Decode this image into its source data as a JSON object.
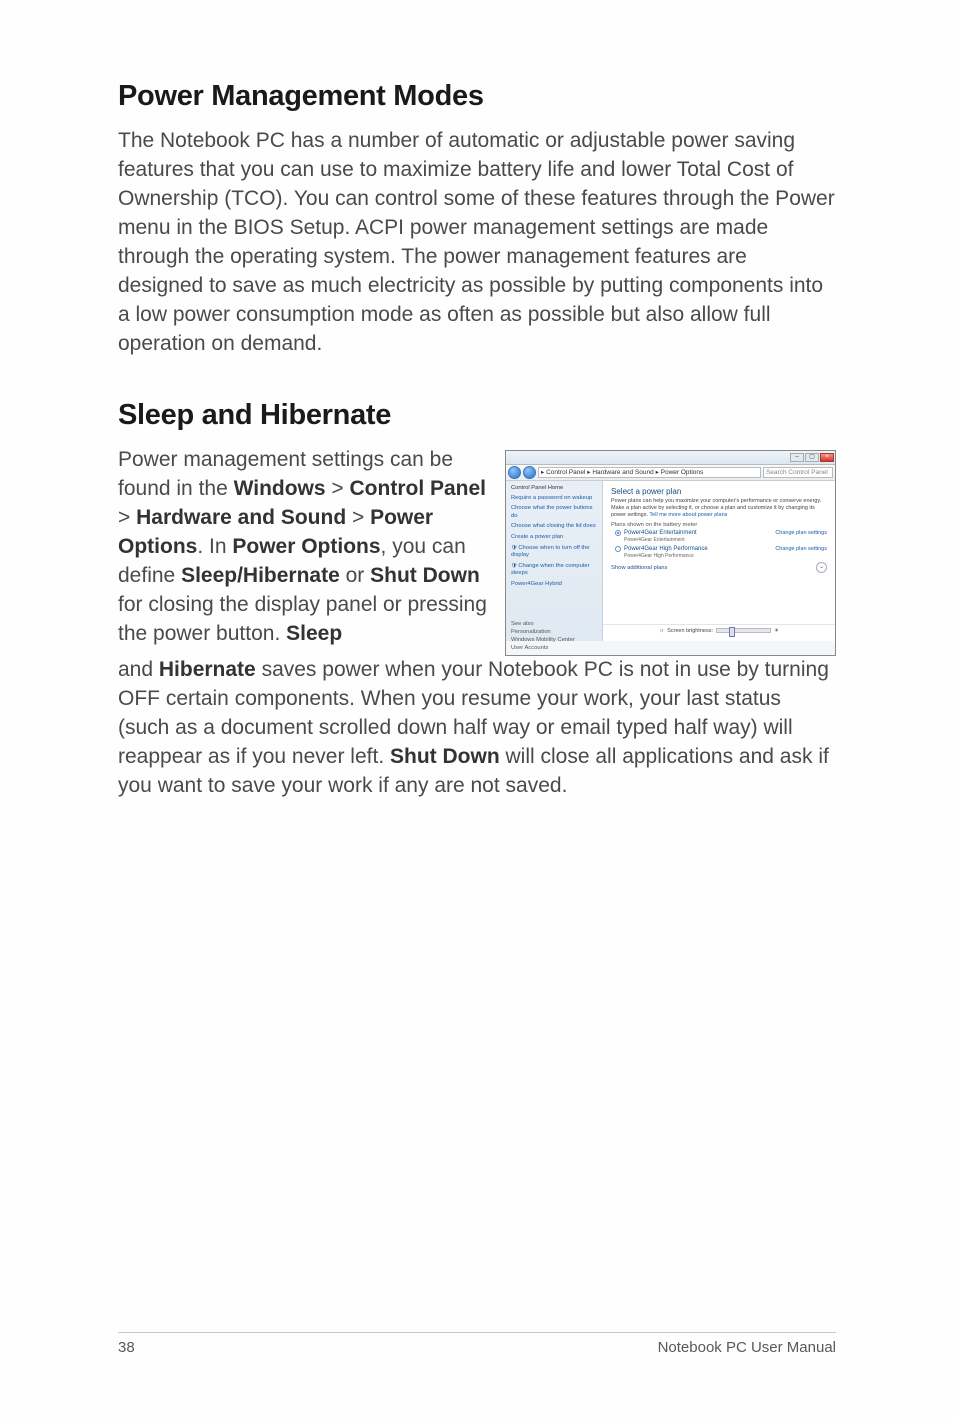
{
  "headings": {
    "h1": "Power Management Modes",
    "h2": "Sleep and Hibernate"
  },
  "paragraphs": {
    "intro": "The Notebook PC has a number of automatic or adjustable power saving features that you can use to maximize battery life and lower Total Cost of Ownership (TCO). You can control some of these features through the Power menu in the BIOS Setup. ACPI power management settings are made through the operating system. The power management features are designed to save as much electricity as possible by putting components into a low power consumption mode as often as possible but also allow full operation on demand.",
    "sleep_pre": "Power management settings can be found in the ",
    "sleep_b1": "Windows",
    "sleep_gt1": " > ",
    "sleep_b2": "Control Panel",
    "sleep_gt2": " > ",
    "sleep_b3": "Hardware and Sound",
    "sleep_gt3": " > ",
    "sleep_b4": "Power Options",
    "sleep_mid1": ". In ",
    "sleep_b5": "Power Options",
    "sleep_mid2": ", you can define ",
    "sleep_b6": "Sleep/Hibernate",
    "sleep_or": " or ",
    "sleep_b7": "Shut Down",
    "sleep_mid3": " for closing the display panel or pressing the power button. ",
    "sleep_b8": "Sleep",
    "cont_pre": "and ",
    "cont_b1": "Hibernate",
    "cont_mid1": " saves power when your Notebook PC is not in use by turning OFF certain components. When you resume your work, your last status (such as a document scrolled down half way or email typed half way) will reappear as if you never left. ",
    "cont_b2": "Shut Down",
    "cont_mid2": " will close all applications and ask if you want to save your work if any are not saved."
  },
  "screenshot": {
    "breadcrumb": "▸ Control Panel ▸ Hardware and Sound ▸ Power Options",
    "search_placeholder": "Search Control Panel",
    "side": {
      "home": "Control Panel Home",
      "l1": "Require a password on wakeup",
      "l2": "Choose what the power buttons do",
      "l3": "Choose what closing the lid does",
      "l4": "Create a power plan",
      "l5": "Choose when to turn off the display",
      "l6": "Change when the computer sleeps",
      "l7": "Power4Gear Hybrid",
      "see_also": "See also",
      "b1": "Personalization",
      "b2": "Windows Mobility Center",
      "b3": "User Accounts"
    },
    "main": {
      "title": "Select a power plan",
      "desc_a": "Power plans can help you maximize your computer's performance or conserve energy. Make a plan active by selecting it, or choose a plan and customize it by changing its power settings. ",
      "desc_link": "Tell me more about power plans",
      "group": "Plans shown on the battery meter",
      "plan1": "Power4Gear Entertainment",
      "plan1_sub": "Power4Gear Entertainment",
      "plan2": "Power4Gear High Performance",
      "plan2_sub": "Power4Gear High Performance",
      "change": "Change plan settings",
      "show_add": "Show additional plans",
      "brightness": "Screen brightness:"
    }
  },
  "footer": {
    "page": "38",
    "title": "Notebook PC User Manual"
  }
}
